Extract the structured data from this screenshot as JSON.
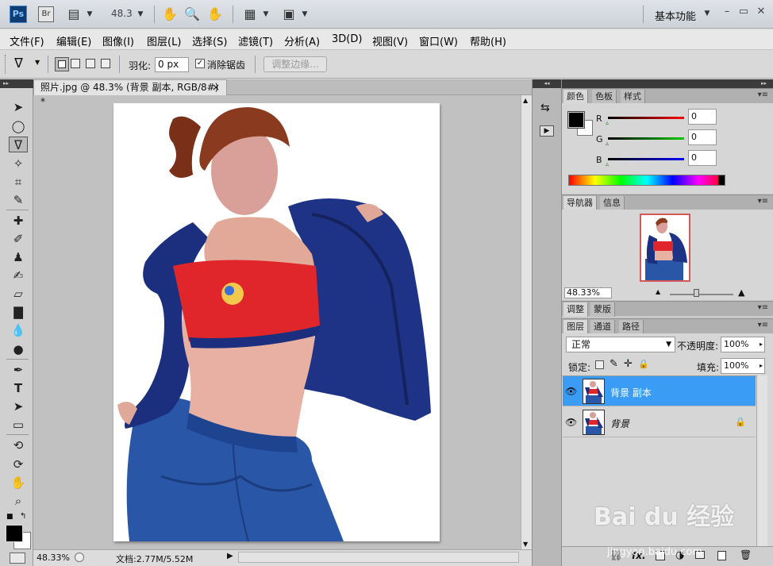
{
  "appbar": {
    "ps_logo": "Ps",
    "br_logo": "Br",
    "zoom_value": "48.3",
    "workspace": "基本功能",
    "icons": [
      "mini-bridge-icon",
      "hand-icon",
      "zoom-icon",
      "rotate-view-icon",
      "arrange-documents-icon",
      "screen-mode-icon"
    ]
  },
  "menu": [
    "文件(F)",
    "编辑(E)",
    "图像(I)",
    "图层(L)",
    "选择(S)",
    "滤镜(T)",
    "分析(A)",
    "3D(D)",
    "视图(V)",
    "窗口(W)",
    "帮助(H)"
  ],
  "options": {
    "feather_label": "羽化:",
    "feather_value": "0 px",
    "antialias_label": "消除锯齿",
    "antialias_checked": true,
    "refine_edge": "调整边缘..."
  },
  "document": {
    "tab_title": "照片.jpg @ 48.3% (背景 副本, RGB/8#) *",
    "close": "×",
    "status_zoom": "48.33%",
    "status_doc": "文档:2.77M/5.52M"
  },
  "color_panel": {
    "tabs": [
      "颜色",
      "色板",
      "样式"
    ],
    "r_label": "R",
    "g_label": "G",
    "b_label": "B",
    "r": "0",
    "g": "0",
    "b": "0",
    "foreground": "#000000",
    "background": "#ffffff"
  },
  "navigator_panel": {
    "tabs": [
      "导航器",
      "信息"
    ],
    "zoom": "48.33%"
  },
  "adjust_panel": {
    "tabs": [
      "调整",
      "蒙版"
    ]
  },
  "layers_panel": {
    "tabs": [
      "图层",
      "通道",
      "路径"
    ],
    "blend_mode": "正常",
    "opacity_label": "不透明度:",
    "opacity": "100%",
    "lock_label": "锁定:",
    "fill_label": "填充:",
    "fill": "100%",
    "layers": [
      {
        "name": "背景 副本",
        "selected": true
      },
      {
        "name": "背景",
        "selected": false,
        "locked": true
      }
    ],
    "fx": "fx."
  },
  "watermark": {
    "text": "Bai du 经验",
    "url": "jingyan.baidu.com"
  }
}
